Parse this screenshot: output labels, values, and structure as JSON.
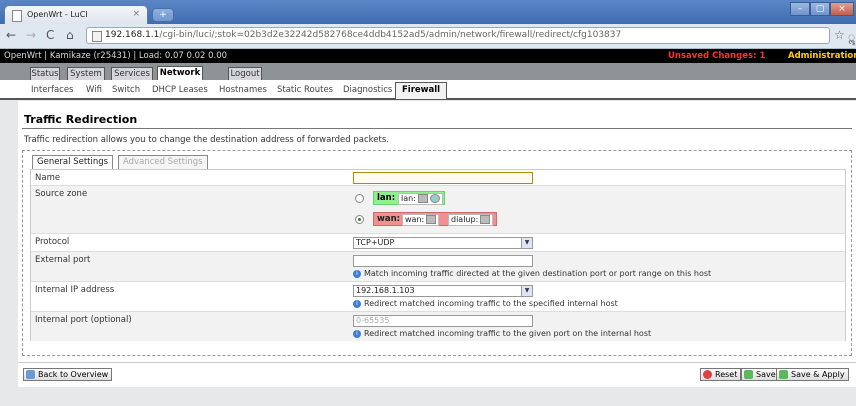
{
  "browser": {
    "tab_title": "OpenWrt - LuCI",
    "tab_close": "×",
    "new_tab": "+",
    "url_host": "192.168.1.1",
    "url_path": "/cgi-bin/luci/;stok=02b3d2e32242d582768ce4ddb4152ad5/admin/network/firewall/redirect/cfg103837",
    "window_min": "–",
    "window_max": "▢",
    "window_close": "×"
  },
  "luci": {
    "hostline": "OpenWrt | Kamikaze (r25431) | Load: 0.07 0.02 0.00",
    "unsaved": "Unsaved Changes: 1",
    "admin": "Administration",
    "main_tabs": [
      "Status",
      "System",
      "Services",
      "Network",
      "Logout"
    ],
    "sub_tabs": [
      "Interfaces",
      "Wifi",
      "Switch",
      "DHCP Leases",
      "Hostnames",
      "Static Routes",
      "Diagnostics",
      "Firewall"
    ]
  },
  "page": {
    "title": "Traffic Redirection",
    "intro": "Traffic redirection allows you to change the destination address of forwarded packets.",
    "section_tabs": [
      "General Settings",
      "Advanced Settings"
    ]
  },
  "form": {
    "name_label": "Name",
    "name_value": "",
    "source_zone_label": "Source zone",
    "zones": {
      "lan_name": "lan:",
      "lan_net": "lan:",
      "wan_name": "wan:",
      "wan_net": "wan:",
      "dialup_net": "dialup:",
      "selected": "wan"
    },
    "protocol_label": "Protocol",
    "protocol_value": "TCP+UDP",
    "external_port_label": "External port",
    "external_port_value": "",
    "external_port_hint": "Match incoming traffic directed at the given destination port or port range on this host",
    "internal_ip_label": "Internal IP address",
    "internal_ip_value": "192.168.1.103",
    "internal_ip_hint": "Redirect matched incoming traffic to the specified internal host",
    "internal_port_label": "Internal port (optional)",
    "internal_port_placeholder": "0-65535",
    "internal_port_hint": "Redirect matched incoming traffic to the given port on the internal host"
  },
  "footer": {
    "back": "Back to Overview",
    "reset": "Reset",
    "save": "Save",
    "save_apply": "Save & Apply"
  },
  "colors": {
    "unsaved": "#ff3030",
    "admin": "#ffd000",
    "lan_zone": "#90f090",
    "wan_zone": "#f09090"
  }
}
